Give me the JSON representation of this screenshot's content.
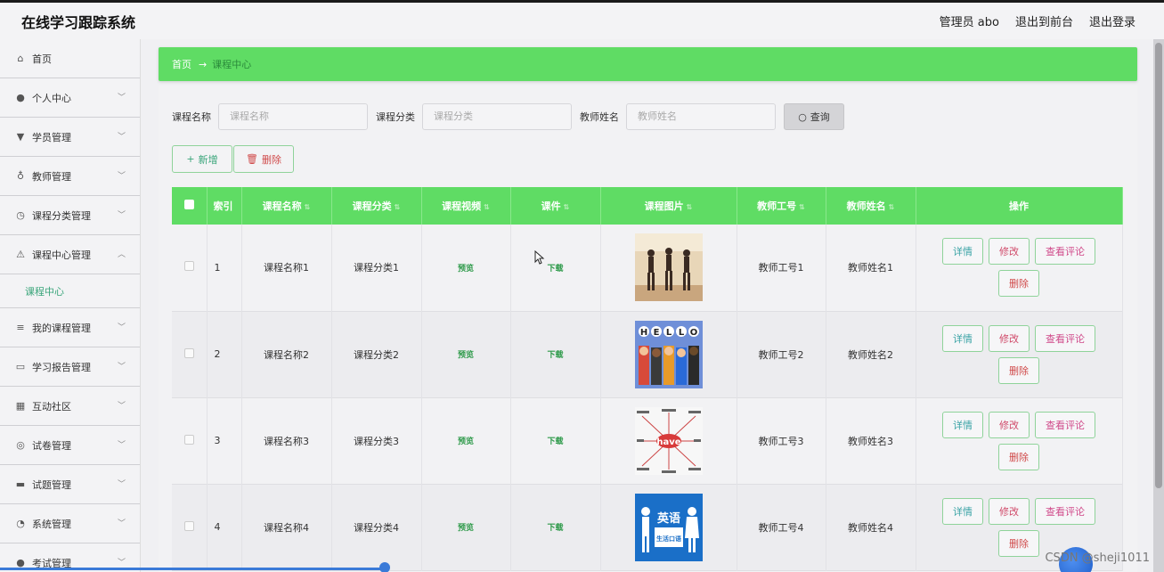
{
  "header": {
    "title": "在线学习跟踪系统",
    "admin_label": "管理员 abo",
    "front_label": "退出到前台",
    "logout_label": "退出登录"
  },
  "sidebar": {
    "items": [
      {
        "label": "首页",
        "icon": "home-icon",
        "glyph": "⌂",
        "chevron": ""
      },
      {
        "label": "个人中心",
        "icon": "user-icon",
        "glyph": "●",
        "chevron": "﹀"
      },
      {
        "label": "学员管理",
        "icon": "student-icon",
        "glyph": "▼",
        "chevron": "﹀"
      },
      {
        "label": "教师管理",
        "icon": "microphone-icon",
        "glyph": "♁",
        "chevron": "﹀"
      },
      {
        "label": "课程分类管理",
        "icon": "gauge-icon",
        "glyph": "◷",
        "chevron": "﹀"
      },
      {
        "label": "课程中心管理",
        "icon": "bell-off-icon",
        "glyph": "⚠",
        "chevron": "︿"
      },
      {
        "label": "我的课程管理",
        "icon": "sliders-icon",
        "glyph": "≡",
        "chevron": "﹀"
      },
      {
        "label": "学习报告管理",
        "icon": "chat-icon",
        "glyph": "▭",
        "chevron": "﹀"
      },
      {
        "label": "互动社区",
        "icon": "grid-icon",
        "glyph": "▦",
        "chevron": "﹀"
      },
      {
        "label": "试卷管理",
        "icon": "support-icon",
        "glyph": "◎",
        "chevron": "﹀"
      },
      {
        "label": "试题管理",
        "icon": "monitor-icon",
        "glyph": "▬",
        "chevron": "﹀"
      },
      {
        "label": "系统管理",
        "icon": "clock-icon",
        "glyph": "◔",
        "chevron": "﹀"
      },
      {
        "label": "考试管理",
        "icon": "location-icon",
        "glyph": "●",
        "chevron": "﹀"
      }
    ],
    "submenu": {
      "label": "课程中心"
    }
  },
  "breadcrumb": {
    "home": "首页",
    "arrow": "→",
    "current": "课程中心"
  },
  "search": {
    "name_label": "课程名称",
    "name_placeholder": "课程名称",
    "category_label": "课程分类",
    "category_placeholder": "课程分类",
    "teacher_label": "教师姓名",
    "teacher_placeholder": "教师姓名",
    "query_label": "查询"
  },
  "actions": {
    "add_label": "新增",
    "delete_label": "删除"
  },
  "table": {
    "columns": [
      "索引",
      "课程名称",
      "课程分类",
      "课程视频",
      "课件",
      "课程图片",
      "教师工号",
      "教师姓名",
      "操作"
    ],
    "rows": [
      {
        "index": "1",
        "name": "课程名称1",
        "category": "课程分类1",
        "video": "预览",
        "courseware": "下载",
        "teacher_no": "教师工号1",
        "teacher_name": "教师姓名1"
      },
      {
        "index": "2",
        "name": "课程名称2",
        "category": "课程分类2",
        "video": "预览",
        "courseware": "下载",
        "teacher_no": "教师工号2",
        "teacher_name": "教师姓名2"
      },
      {
        "index": "3",
        "name": "课程名称3",
        "category": "课程分类3",
        "video": "预览",
        "courseware": "下载",
        "teacher_no": "教师工号3",
        "teacher_name": "教师姓名3"
      },
      {
        "index": "4",
        "name": "课程名称4",
        "category": "课程分类4",
        "video": "预览",
        "courseware": "下载",
        "teacher_no": "教师工号4",
        "teacher_name": "教师姓名4"
      }
    ],
    "op_labels": {
      "detail": "详情",
      "edit": "修改",
      "review": "查看评论",
      "delete": "删除"
    },
    "thumb_texts": {
      "hello": "HELLO",
      "have": "have",
      "english_a": "英语",
      "english_b": "生活口语"
    }
  },
  "watermark": "CSDN @sheji1011",
  "colors": {
    "accent": "#5fdc64",
    "link": "#2e9a4a",
    "danger": "#d04a4a"
  }
}
